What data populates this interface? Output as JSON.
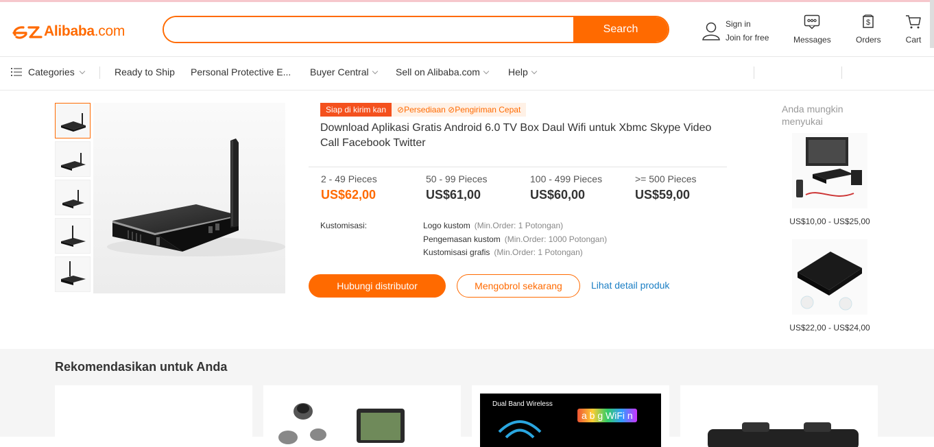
{
  "header": {
    "logo_text": "Alibaba",
    "logo_suffix": ".com",
    "search_placeholder": "",
    "search_button": "Search",
    "sign_in": "Sign in",
    "join": "Join for free",
    "messages": "Messages",
    "orders": "Orders",
    "cart": "Cart"
  },
  "nav": {
    "categories": "Categories",
    "ready_to_ship": "Ready to Ship",
    "ppe": "Personal Protective E...",
    "buyer_central": "Buyer Central",
    "sell": "Sell on Alibaba.com",
    "help": "Help"
  },
  "product": {
    "tag_ship": "Siap di kirim kan",
    "tag_stock": "Persediaan",
    "tag_fast": "Pengiriman Cepat",
    "title": "Download Aplikasi Gratis Android 6.0 TV Box Daul Wifi untuk Xbmc Skype Video Call Facebook Twitter",
    "tiers": [
      {
        "qty": "2 - 49 Pieces",
        "price": "US$62,00"
      },
      {
        "qty": "50 - 99 Pieces",
        "price": "US$61,00"
      },
      {
        "qty": "100 - 499 Pieces",
        "price": "US$60,00"
      },
      {
        "qty": ">= 500 Pieces",
        "price": "US$59,00"
      }
    ],
    "customization_label": "Kustomisasi:",
    "customizations": [
      {
        "name": "Logo kustom",
        "moq": "(Min.Order: 1 Potongan)"
      },
      {
        "name": "Pengemasan kustom",
        "moq": "(Min.Order: 1000 Potongan)"
      },
      {
        "name": "Kustomisasi grafis",
        "moq": "(Min.Order: 1 Potongan)"
      }
    ],
    "contact_button": "Hubungi distributor",
    "chat_button": "Mengobrol sekarang",
    "detail_link": "Lihat detail produk"
  },
  "side": {
    "title": "Anda mungkin menyukai",
    "items": [
      {
        "price": "US$10,00 - US$25,00"
      },
      {
        "price": "US$22,00 - US$24,00"
      }
    ]
  },
  "reco": {
    "title": "Rekomendasikan untuk Anda",
    "card3_line1": "Dual Band Wireless",
    "card3_line2": "a b g WiFi n"
  },
  "colors": {
    "accent": "#ff6a00",
    "link": "#1a7ec4",
    "tag_red": "#f4511e"
  }
}
